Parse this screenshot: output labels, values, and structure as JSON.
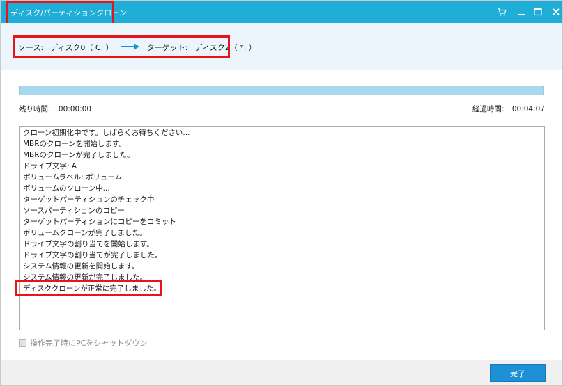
{
  "window": {
    "title": "ディスク/パーティションクローン"
  },
  "titlebar_icons": [
    "cart-icon",
    "minimize-icon",
    "maximize-icon",
    "close-icon"
  ],
  "source": {
    "source_label": "ソース:",
    "source_value": "ディスク0（ C: ）",
    "target_label": "ターゲット:",
    "target_value": "ディスク2（ *: ）"
  },
  "progress": {
    "percent": 100
  },
  "time": {
    "remaining_label": "残り時間:",
    "remaining_value": "00:00:00",
    "elapsed_label": "経過時間:",
    "elapsed_value": "00:04:07"
  },
  "log": [
    "クローン初期化中です。しばらくお待ちください...",
    "MBRのクローンを開始します。",
    "MBRのクローンが完了しました。",
    "ドライブ文字: A",
    "ボリュームラベル: ボリューム",
    "ボリュームのクローン中...",
    "ターゲットパーティションのチェック中",
    "ソースパーティションのコピー",
    "ターゲットパーティションにコピーをコミット",
    "ボリュームクローンが完了しました。",
    "ドライブ文字の割り当てを開始します。",
    "ドライブ文字の割り当てが完了しました。",
    "システム情報の更新を開始します。",
    "システム情報の更新が完了しました。",
    "ディスククローンが正常に完了しました。"
  ],
  "options": {
    "shutdown_label": "操作完了時にPCをシャットダウン",
    "shutdown_checked": false
  },
  "footer": {
    "finish_label": "完了"
  },
  "colors": {
    "titlebar": "#1eaed8",
    "accent_button": "#1e90d6",
    "highlight": "#e8141c",
    "strip": "#ebf5fb"
  }
}
